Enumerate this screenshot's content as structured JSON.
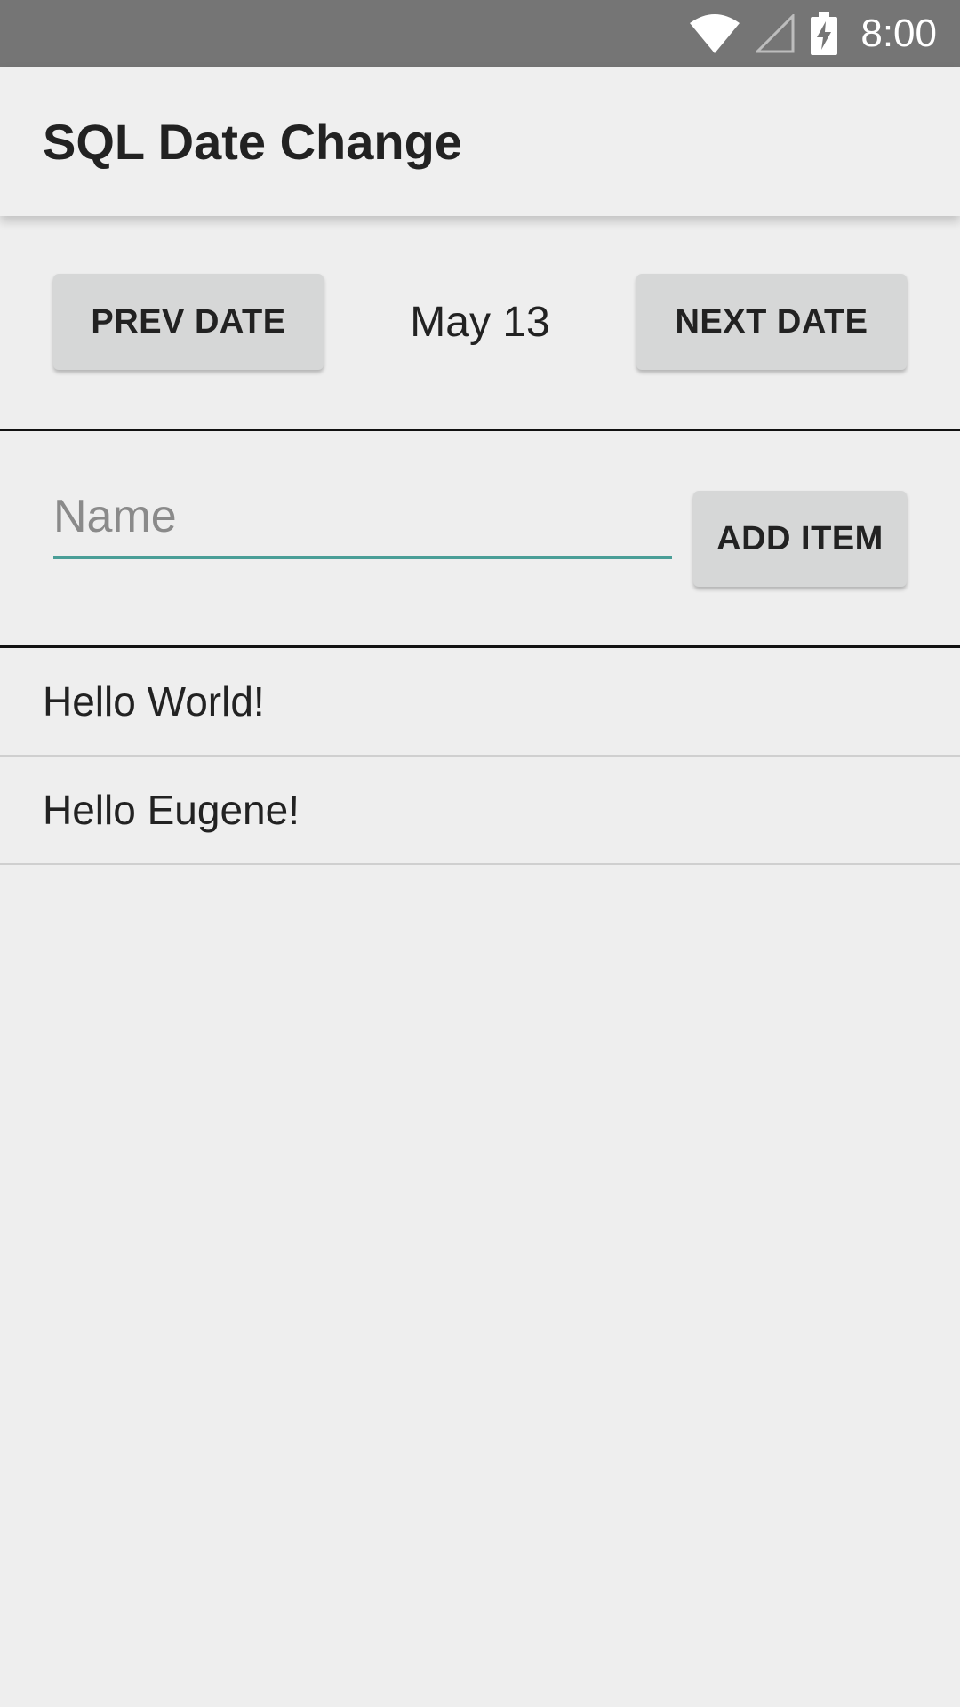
{
  "status_bar": {
    "time": "8:00",
    "icons": [
      "wifi-icon",
      "cell-signal-icon",
      "battery-charging-icon"
    ],
    "background": "#757575"
  },
  "app_bar": {
    "title": "SQL Date Change"
  },
  "date_nav": {
    "prev_label": "PREV DATE",
    "current_date": "May 13",
    "next_label": "NEXT DATE"
  },
  "add_form": {
    "name_placeholder": "Name",
    "name_value": "",
    "add_label": "ADD ITEM",
    "accent": "#4a9e97"
  },
  "items": [
    {
      "label": "Hello World!"
    },
    {
      "label": "Hello Eugene!"
    }
  ]
}
